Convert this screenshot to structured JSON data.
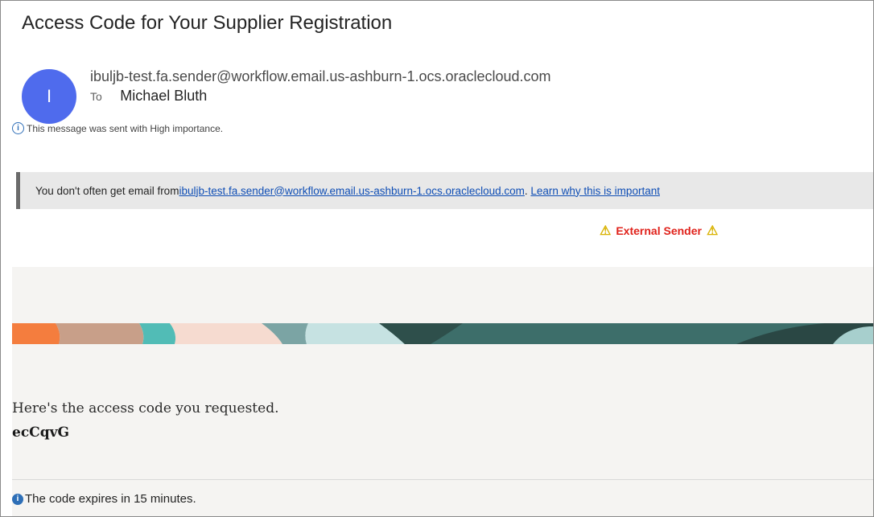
{
  "email": {
    "subject": "Access Code for Your Supplier Registration",
    "avatar_initial": "I",
    "sender_address": "ibuljb-test.fa.sender@workflow.email.us-ashburn-1.ocs.oraclecloud.com",
    "to_label": "To",
    "recipient": "Michael Bluth",
    "importance_icon": "i",
    "importance_text": "This message was sent with High importance."
  },
  "notice": {
    "prefix": "You don't often get email from ",
    "sender_link": "ibuljb-test.fa.sender@workflow.email.us-ashburn-1.ocs.oraclecloud.com",
    "separator": ".",
    "learn_link": "Learn why this is important"
  },
  "external_tag": {
    "warn_icon": "⚠",
    "label": "External Sender"
  },
  "body": {
    "intro": "Here's the access code you requested.",
    "code": "ecCqvG",
    "expiry_icon": "i",
    "expiry": "The code expires in 15 minutes."
  },
  "colors": {
    "avatar": "#4f6bed",
    "link": "#0f4eb5",
    "external_sender": "#e0221b",
    "warning": "#d9b200",
    "info": "#2e6fb7",
    "body_background": "#f5f4f2"
  }
}
